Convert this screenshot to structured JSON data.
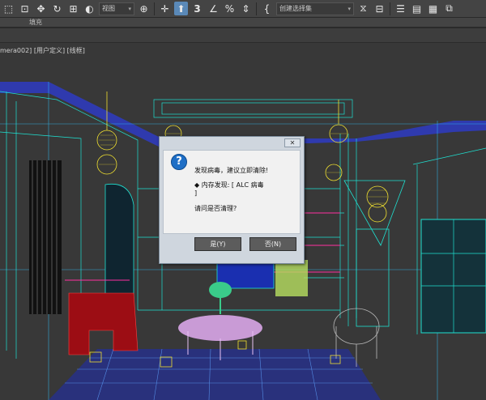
{
  "toolbar": {
    "view_dropdown": "视图",
    "selection_set_dropdown": "创建选择集"
  },
  "subbar": {
    "fill_label": "填充"
  },
  "viewport": {
    "label": "mera002] [用户定义] [线框]"
  },
  "dialog": {
    "close_label": "✕",
    "message_line1": "发现病毒，建议立即清除!",
    "message_line2": "◆ 内存发现: [ ALC 病毒",
    "message_line3": "]",
    "question": "请问是否清理?",
    "yes_button": "是(Y)",
    "no_button": "否(N)"
  },
  "colors": {
    "dialog_accent": "#1f6fc6",
    "wire_cyan": "#1fe0d0",
    "wire_yellow": "#f0e030",
    "wire_blue": "#2e3bd8"
  }
}
